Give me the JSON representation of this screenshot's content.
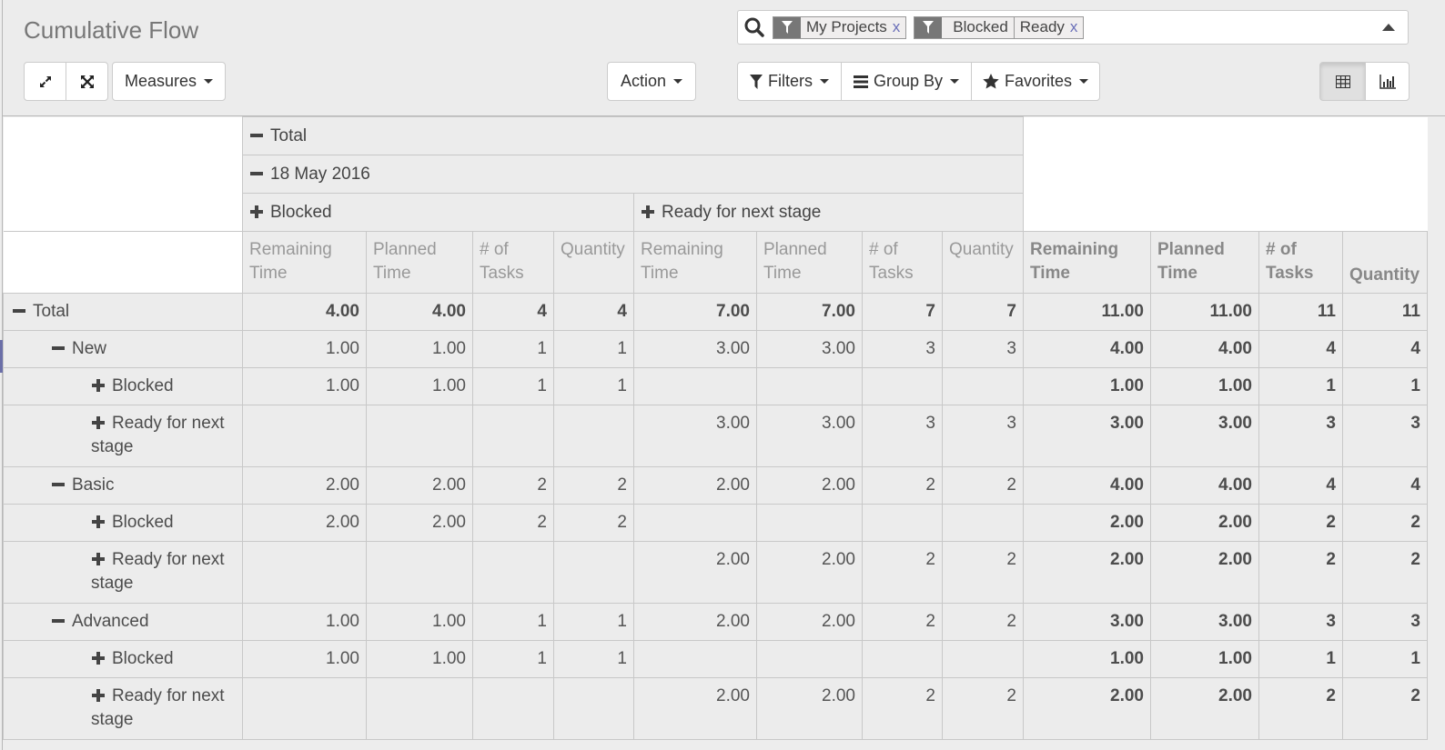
{
  "header": {
    "title": "Cumulative Flow",
    "buttons": {
      "expand_all": "expand-icon",
      "full_expand": "arrows-icon",
      "measures": "Measures",
      "action": "Action"
    }
  },
  "search": {
    "facets": [
      {
        "icon": "filter-icon",
        "values": [
          "My Projects"
        ],
        "remove": "x"
      },
      {
        "icon": "filter-icon",
        "values": [
          "Blocked",
          "Ready"
        ],
        "remove": "x"
      }
    ]
  },
  "search_options": {
    "filters": "Filters",
    "group_by": "Group By",
    "favorites": "Favorites"
  },
  "view_switcher": {
    "pivot": "pivot-view",
    "graph": "graph-view",
    "active": "pivot"
  },
  "pivot": {
    "col_headers": {
      "total": "Total",
      "date": "18 May 2016",
      "groups": [
        "Blocked",
        "Ready for next stage"
      ]
    },
    "measures": [
      "Remaining Time",
      "Planned Time",
      "# of Tasks",
      "Quantity"
    ],
    "rows": [
      {
        "label": "Total",
        "level": 0,
        "sign": "minus",
        "values": [
          "4.00",
          "4.00",
          "4",
          "4",
          "7.00",
          "7.00",
          "7",
          "7",
          "11.00",
          "11.00",
          "11",
          "11"
        ]
      },
      {
        "label": "New",
        "level": 1,
        "sign": "minus",
        "values": [
          "1.00",
          "1.00",
          "1",
          "1",
          "3.00",
          "3.00",
          "3",
          "3",
          "4.00",
          "4.00",
          "4",
          "4"
        ]
      },
      {
        "label": "Blocked",
        "level": 2,
        "sign": "plus",
        "values": [
          "1.00",
          "1.00",
          "1",
          "1",
          "",
          "",
          "",
          "",
          "1.00",
          "1.00",
          "1",
          "1"
        ]
      },
      {
        "label": "Ready for next stage",
        "level": 2,
        "sign": "plus",
        "values": [
          "",
          "",
          "",
          "",
          "3.00",
          "3.00",
          "3",
          "3",
          "3.00",
          "3.00",
          "3",
          "3"
        ]
      },
      {
        "label": "Basic",
        "level": 1,
        "sign": "minus",
        "values": [
          "2.00",
          "2.00",
          "2",
          "2",
          "2.00",
          "2.00",
          "2",
          "2",
          "4.00",
          "4.00",
          "4",
          "4"
        ]
      },
      {
        "label": "Blocked",
        "level": 2,
        "sign": "plus",
        "values": [
          "2.00",
          "2.00",
          "2",
          "2",
          "",
          "",
          "",
          "",
          "2.00",
          "2.00",
          "2",
          "2"
        ]
      },
      {
        "label": "Ready for next stage",
        "level": 2,
        "sign": "plus",
        "values": [
          "",
          "",
          "",
          "",
          "2.00",
          "2.00",
          "2",
          "2",
          "2.00",
          "2.00",
          "2",
          "2"
        ]
      },
      {
        "label": "Advanced",
        "level": 1,
        "sign": "minus",
        "values": [
          "1.00",
          "1.00",
          "1",
          "1",
          "2.00",
          "2.00",
          "2",
          "2",
          "3.00",
          "3.00",
          "3",
          "3"
        ]
      },
      {
        "label": "Blocked",
        "level": 2,
        "sign": "plus",
        "values": [
          "1.00",
          "1.00",
          "1",
          "1",
          "",
          "",
          "",
          "",
          "1.00",
          "1.00",
          "1",
          "1"
        ]
      },
      {
        "label": "Ready for next stage",
        "level": 2,
        "sign": "plus",
        "values": [
          "",
          "",
          "",
          "",
          "2.00",
          "2.00",
          "2",
          "2",
          "2.00",
          "2.00",
          "2",
          "2"
        ]
      }
    ]
  }
}
